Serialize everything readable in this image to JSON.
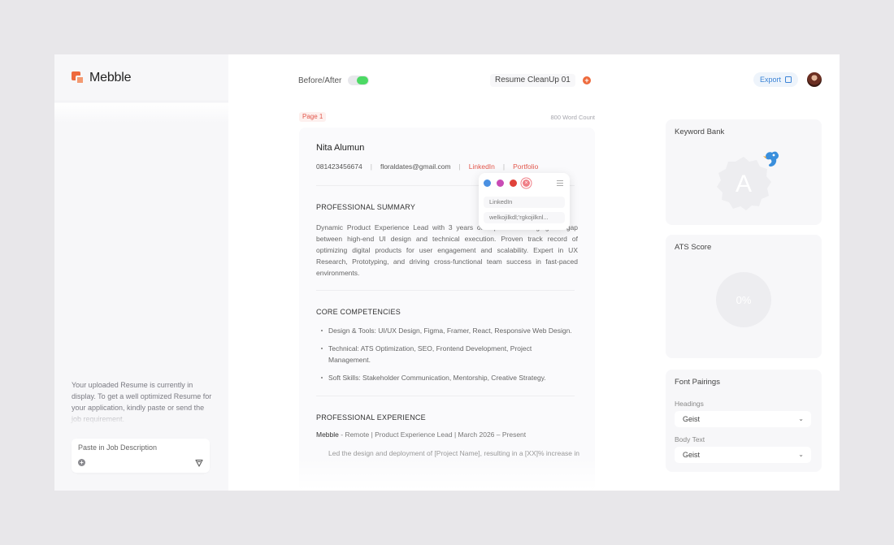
{
  "sidebar": {
    "logo_text": "Mebble",
    "upload_note": "Your uploaded Resume is currently in display. To get a well optimized Resume for your application, kindly paste or send the job requirement.",
    "job_description_placeholder": "Paste in Job Description"
  },
  "topbar": {
    "before_after_label": "Before/After",
    "before_after_on": true,
    "document_title": "Resume CleanUp 01",
    "export_label": "Export"
  },
  "document": {
    "page_label": "Page 1",
    "word_count": "800 Word Count",
    "name": "Nita Alumun",
    "phone": "081423456674",
    "email": "floraldates@gmail.com",
    "links": [
      "LinkedIn",
      "Portfolio"
    ],
    "summary_heading": "PROFESSIONAL SUMMARY",
    "summary": "Dynamic Product Experience Lead with 3 years of experience bridging the gap between high-end UI design and technical execution. Proven track record of optimizing digital products for user engagement and scalability. Expert in UX Research, Prototyping, and driving cross-functional team success in fast-paced environments.",
    "competencies_heading": "CORE COMPETENCIES",
    "competencies": [
      "Design & Tools: UI/UX Design, Figma, Framer, React, Responsive Web Design.",
      "Technical: ATS Optimization, SEO, Frontend Development, Project Management.",
      "Soft Skills: Stakeholder Communication, Mentorship, Creative Strategy."
    ],
    "experience_heading": "PROFESSIONAL EXPERIENCE",
    "experience_company": "Mebble",
    "experience_detail": " - Remote | Product Experience Lead | March 2026 – Present",
    "experience_bullet": "Led the design and deployment of [Project Name], resulting in a [XX]% increase in user engagement."
  },
  "link_popover": {
    "colors": [
      "#4a90e2",
      "#c94bb5",
      "#e0423a",
      "#f07f87"
    ],
    "label_value": "LinkedIn",
    "url_value": "welkojilkdl;'rgkojilknl..."
  },
  "keyword_bank": {
    "title": "Keyword Bank",
    "badge_letter": "A"
  },
  "ats": {
    "title": "ATS Score",
    "score": "0%"
  },
  "font_pairings": {
    "title": "Font Pairings",
    "headings_label": "Headings",
    "headings_value": "Geist",
    "body_label": "Body Text",
    "body_value": "Geist"
  },
  "colors": {
    "accent_orange": "#ee6a3c",
    "link_red": "#e2574c",
    "toggle_green": "#4cd964",
    "export_blue": "#3a83d6"
  }
}
